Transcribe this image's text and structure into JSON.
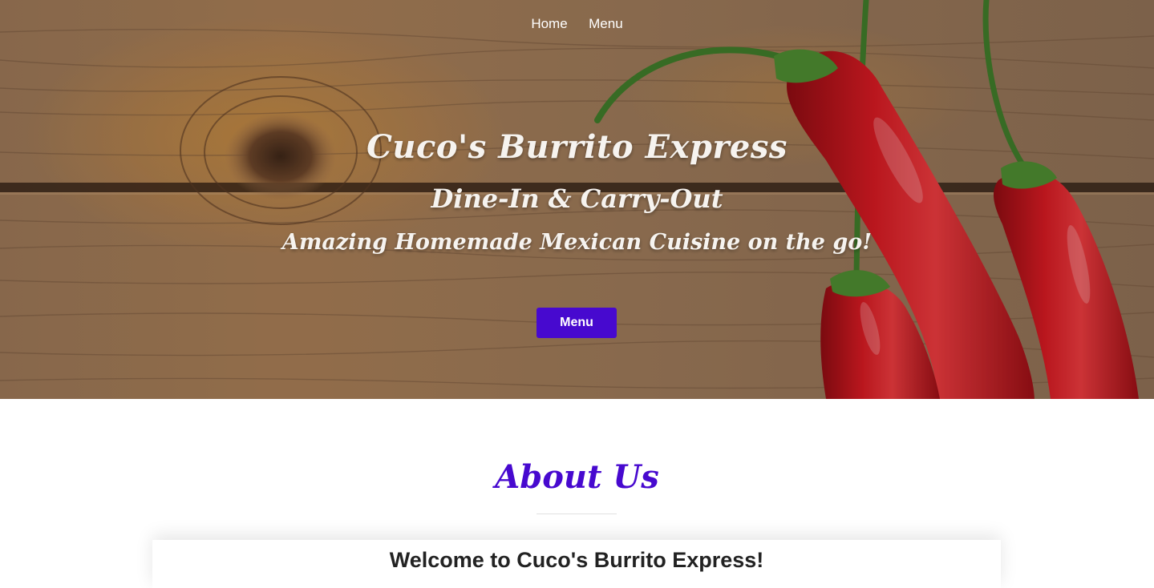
{
  "nav": {
    "items": [
      {
        "label": "Home"
      },
      {
        "label": "Menu"
      }
    ]
  },
  "hero": {
    "title": "Cuco's Burrito Express",
    "subtitle": "Dine-In & Carry-Out",
    "tagline": "Amazing Homemade Mexican Cuisine on the go!",
    "button_label": "Menu",
    "background": "wooden planks with red chili peppers"
  },
  "about": {
    "title": "About Us",
    "welcome_heading": "Welcome to Cuco's Burrito Express!"
  },
  "colors": {
    "accent": "#4709cf",
    "hero_text": "#f6f3ef",
    "pepper_red": "#c8141c",
    "stem_green": "#3f7a2a"
  }
}
